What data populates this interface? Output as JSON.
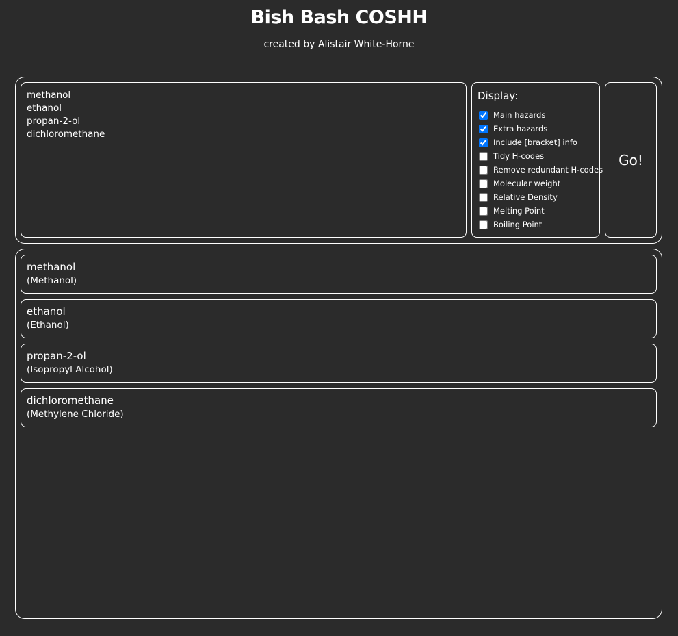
{
  "header": {
    "title": "Bish Bash COSHH",
    "subtitle": "created by Alistair White-Horne"
  },
  "input": {
    "value": "methanol\nethanol\npropan-2-ol\ndichloromethane"
  },
  "display": {
    "label": "Display:",
    "options": [
      {
        "label": "Main hazards",
        "checked": true
      },
      {
        "label": "Extra hazards",
        "checked": true
      },
      {
        "label": "Include [bracket] info",
        "checked": true
      },
      {
        "label": "Tidy H-codes",
        "checked": false
      },
      {
        "label": "Remove redundant H-codes",
        "checked": false
      },
      {
        "label": "Molecular weight",
        "checked": false
      },
      {
        "label": "Relative Density",
        "checked": false
      },
      {
        "label": "Melting Point",
        "checked": false
      },
      {
        "label": "Boiling Point",
        "checked": false
      }
    ]
  },
  "go_button": {
    "label": "Go!"
  },
  "results": [
    {
      "name": "methanol",
      "common": "(Methanol)"
    },
    {
      "name": "ethanol",
      "common": "(Ethanol)"
    },
    {
      "name": "propan-2-ol",
      "common": "(Isopropyl Alcohol)"
    },
    {
      "name": "dichloromethane",
      "common": "(Methylene Chloride)"
    }
  ],
  "colors": {
    "background": "#2b2b2b",
    "border": "#ffffff",
    "checkbox_accent": "#0075ff"
  }
}
